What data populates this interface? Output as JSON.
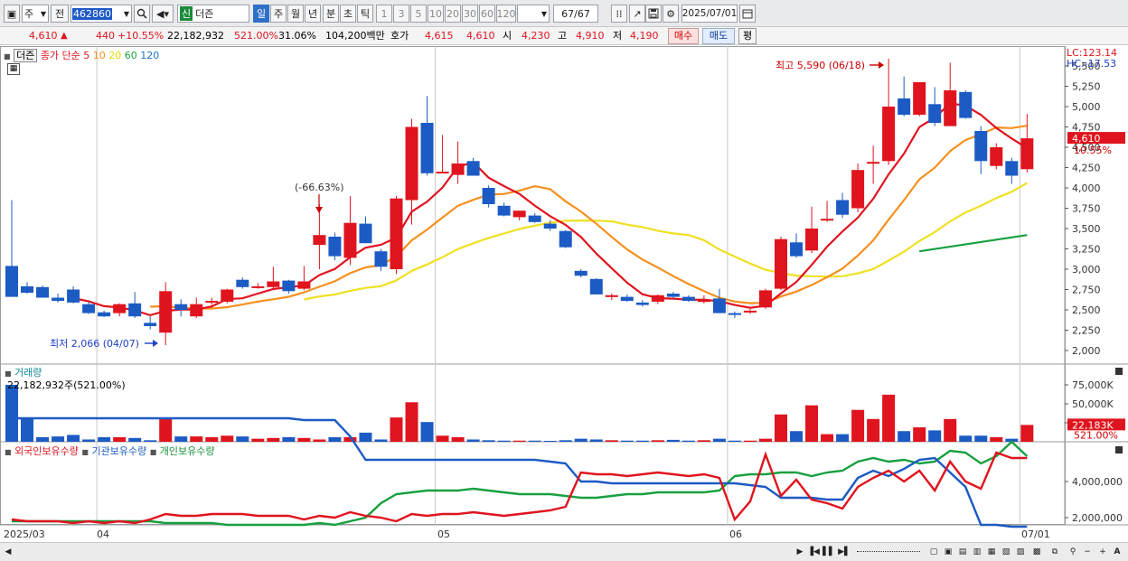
{
  "toolbar": {
    "market": "주",
    "prev_label": "전",
    "code": "462860",
    "stock_name": "더즌",
    "stock_badge": "신",
    "periods": [
      "일",
      "주",
      "월",
      "년",
      "분",
      "초",
      "틱"
    ],
    "active_period": "일",
    "ranges": [
      "1",
      "3",
      "5",
      "10",
      "20",
      "30",
      "60",
      "120"
    ],
    "count": "67",
    "count_total": "/67",
    "date": "2025/07/01"
  },
  "quote": {
    "price": "4,610",
    "change": "440",
    "change_pct": "+10.55%",
    "volume": "22,182,932",
    "volume_ratio": "521.00%",
    "turnover": "31.06%",
    "amount": "104,200백만",
    "hoga_label": "호가",
    "ask": "4,615",
    "bid": "4,610",
    "open_label": "시",
    "open": "4,230",
    "high_label": "고",
    "high": "4,910",
    "low_label": "저",
    "low": "4,190",
    "buy_label": "매수",
    "sell_label": "매도",
    "flat_label": "평"
  },
  "price_panel": {
    "tab": "더즌",
    "ma_title": "종가 단순",
    "ma_periods": [
      "5",
      "10",
      "20",
      "60",
      "120"
    ],
    "lc": "LC:123.14",
    "hc": "HC:-17.53",
    "current_tag": "4,610",
    "current_pct": "10.55%",
    "max_note": "최고 5,590 (06/18)",
    "min_note": "최저 2,066 (04/07)",
    "drop_note": "(-66.63%)",
    "y_ticks": [
      "5,500",
      "5,250",
      "5,000",
      "4,750",
      "4,500",
      "4,250",
      "4,000",
      "3,750",
      "3,500",
      "3,250",
      "3,000",
      "2,750",
      "2,500",
      "2,250",
      "2,000"
    ]
  },
  "volume_panel": {
    "title": "거래량",
    "info": "22,182,932주(521.00%)",
    "y_ticks": [
      "75,000K",
      "50,000K",
      "25,000K"
    ],
    "current_tag": "22,183K",
    "current_pct": "521.00%"
  },
  "holdings_panel": {
    "foreign": "외국인보유수량",
    "institution": "기관보유수량",
    "individual": "개인보유수량",
    "y_ticks": [
      "4,000,000",
      "2,000,000"
    ]
  },
  "x_axis": [
    "2025/03",
    "04",
    "05",
    "06",
    "07/01"
  ],
  "colors": {
    "up": "#e0141e",
    "down": "#1c5bc4",
    "ma5": "#e01420",
    "ma10": "#f5901e",
    "ma20": "#f0e020",
    "ma60": "#18a040",
    "ma120": "#1c70d0"
  },
  "chart_data": {
    "type": "candlestick",
    "candles": [
      {
        "o": 3040,
        "h": 3850,
        "l": 2660,
        "c": 2660
      },
      {
        "o": 2790,
        "h": 2840,
        "l": 2700,
        "c": 2710
      },
      {
        "o": 2780,
        "h": 2800,
        "l": 2650,
        "c": 2650
      },
      {
        "o": 2650,
        "h": 2700,
        "l": 2590,
        "c": 2610
      },
      {
        "o": 2750,
        "h": 2790,
        "l": 2580,
        "c": 2590
      },
      {
        "o": 2570,
        "h": 2600,
        "l": 2450,
        "c": 2460
      },
      {
        "o": 2470,
        "h": 2490,
        "l": 2410,
        "c": 2420
      },
      {
        "o": 2460,
        "h": 2580,
        "l": 2420,
        "c": 2570
      },
      {
        "o": 2580,
        "h": 2720,
        "l": 2400,
        "c": 2420
      },
      {
        "o": 2340,
        "h": 2420,
        "l": 2260,
        "c": 2300
      },
      {
        "o": 2220,
        "h": 2840,
        "l": 2066,
        "c": 2730
      },
      {
        "o": 2570,
        "h": 2630,
        "l": 2420,
        "c": 2500
      },
      {
        "o": 2420,
        "h": 2650,
        "l": 2400,
        "c": 2570
      },
      {
        "o": 2600,
        "h": 2650,
        "l": 2560,
        "c": 2610
      },
      {
        "o": 2600,
        "h": 2760,
        "l": 2580,
        "c": 2750
      },
      {
        "o": 2870,
        "h": 2900,
        "l": 2760,
        "c": 2780
      },
      {
        "o": 2790,
        "h": 2830,
        "l": 2760,
        "c": 2790
      },
      {
        "o": 2780,
        "h": 3030,
        "l": 2750,
        "c": 2850
      },
      {
        "o": 2860,
        "h": 2870,
        "l": 2700,
        "c": 2730
      },
      {
        "o": 2760,
        "h": 3040,
        "l": 2740,
        "c": 2850
      },
      {
        "o": 3300,
        "h": 3800,
        "l": 3000,
        "c": 3420
      },
      {
        "o": 3400,
        "h": 3450,
        "l": 3110,
        "c": 3160
      },
      {
        "o": 3140,
        "h": 3900,
        "l": 3050,
        "c": 3570
      },
      {
        "o": 3560,
        "h": 3650,
        "l": 3320,
        "c": 3320
      },
      {
        "o": 3220,
        "h": 3250,
        "l": 2980,
        "c": 3030
      },
      {
        "o": 3000,
        "h": 3900,
        "l": 2940,
        "c": 3870
      },
      {
        "o": 3850,
        "h": 4850,
        "l": 3550,
        "c": 4750
      },
      {
        "o": 4800,
        "h": 5130,
        "l": 4150,
        "c": 4180
      },
      {
        "o": 4190,
        "h": 4650,
        "l": 4180,
        "c": 4200
      },
      {
        "o": 4160,
        "h": 4570,
        "l": 4050,
        "c": 4300
      },
      {
        "o": 4330,
        "h": 4370,
        "l": 4150,
        "c": 4150
      },
      {
        "o": 4000,
        "h": 4030,
        "l": 3760,
        "c": 3800
      },
      {
        "o": 3780,
        "h": 3820,
        "l": 3650,
        "c": 3660
      },
      {
        "o": 3640,
        "h": 3720,
        "l": 3600,
        "c": 3720
      },
      {
        "o": 3660,
        "h": 3690,
        "l": 3570,
        "c": 3580
      },
      {
        "o": 3560,
        "h": 3600,
        "l": 3470,
        "c": 3500
      },
      {
        "o": 3470,
        "h": 3480,
        "l": 3260,
        "c": 3270
      },
      {
        "o": 2980,
        "h": 3000,
        "l": 2900,
        "c": 2920
      },
      {
        "o": 2880,
        "h": 2890,
        "l": 2690,
        "c": 2690
      },
      {
        "o": 2660,
        "h": 2700,
        "l": 2620,
        "c": 2680
      },
      {
        "o": 2660,
        "h": 2690,
        "l": 2600,
        "c": 2610
      },
      {
        "o": 2590,
        "h": 2620,
        "l": 2540,
        "c": 2560
      },
      {
        "o": 2600,
        "h": 2690,
        "l": 2570,
        "c": 2680
      },
      {
        "o": 2700,
        "h": 2720,
        "l": 2640,
        "c": 2660
      },
      {
        "o": 2660,
        "h": 2680,
        "l": 2600,
        "c": 2610
      },
      {
        "o": 2600,
        "h": 2680,
        "l": 2580,
        "c": 2620
      },
      {
        "o": 2640,
        "h": 2760,
        "l": 2460,
        "c": 2460
      },
      {
        "o": 2460,
        "h": 2480,
        "l": 2400,
        "c": 2450
      },
      {
        "o": 2470,
        "h": 2510,
        "l": 2450,
        "c": 2490
      },
      {
        "o": 2530,
        "h": 2760,
        "l": 2510,
        "c": 2740
      },
      {
        "o": 2760,
        "h": 3400,
        "l": 2740,
        "c": 3370
      },
      {
        "o": 3330,
        "h": 3440,
        "l": 3140,
        "c": 3160
      },
      {
        "o": 3230,
        "h": 3770,
        "l": 3200,
        "c": 3500
      },
      {
        "o": 3600,
        "h": 3840,
        "l": 3580,
        "c": 3620
      },
      {
        "o": 3850,
        "h": 3940,
        "l": 3630,
        "c": 3670
      },
      {
        "o": 3750,
        "h": 4300,
        "l": 3700,
        "c": 4220
      },
      {
        "o": 4300,
        "h": 4520,
        "l": 4050,
        "c": 4320
      },
      {
        "o": 4330,
        "h": 5590,
        "l": 4280,
        "c": 5000
      },
      {
        "o": 5100,
        "h": 5370,
        "l": 4880,
        "c": 4900
      },
      {
        "o": 4900,
        "h": 5290,
        "l": 4880,
        "c": 5300
      },
      {
        "o": 5030,
        "h": 5240,
        "l": 4760,
        "c": 4800
      },
      {
        "o": 4760,
        "h": 5540,
        "l": 4760,
        "c": 5200
      },
      {
        "o": 5180,
        "h": 5200,
        "l": 4850,
        "c": 4860
      },
      {
        "o": 4700,
        "h": 4760,
        "l": 4170,
        "c": 4330
      },
      {
        "o": 4270,
        "h": 4550,
        "l": 4230,
        "c": 4500
      },
      {
        "o": 4330,
        "h": 4370,
        "l": 4050,
        "c": 4150
      },
      {
        "o": 4230,
        "h": 4910,
        "l": 4190,
        "c": 4610
      }
    ],
    "volume_k": [
      75000,
      30000,
      6000,
      7000,
      9000,
      3000,
      6000,
      6000,
      5000,
      2000,
      32000,
      7000,
      7000,
      6000,
      8000,
      7000,
      4000,
      5000,
      6000,
      5000,
      3000,
      6000,
      6000,
      12000,
      3000,
      32000,
      52000,
      26000,
      8000,
      6000,
      3000,
      2000,
      1500,
      1500,
      1500,
      1200,
      2000,
      4000,
      3000,
      2000,
      1500,
      1500,
      2000,
      2500,
      1500,
      2000,
      4000,
      1500,
      1500,
      4000,
      36000,
      14000,
      48000,
      10000,
      10000,
      42000,
      30000,
      62000,
      14000,
      19000,
      15000,
      30000,
      8000,
      8000,
      6000,
      4000,
      22183
    ],
    "holdings": {
      "foreign": [
        1.9,
        1.8,
        1.8,
        1.8,
        1.7,
        1.8,
        1.7,
        1.8,
        1.7,
        1.9,
        2.2,
        2.1,
        2.1,
        2.2,
        2.2,
        2.2,
        2.1,
        2.1,
        2.1,
        1.9,
        2.1,
        2.0,
        2.3,
        2.1,
        2.0,
        1.8,
        2.2,
        2.1,
        2.2,
        2.2,
        2.3,
        2.2,
        2.1,
        2.2,
        2.3,
        2.4,
        2.6,
        4.5,
        4.4,
        4.4,
        4.3,
        4.4,
        4.5,
        4.4,
        4.3,
        4.4,
        4.2,
        1.9,
        2.9,
        5.5,
        3.2,
        4.1,
        3.0,
        2.8,
        2.5,
        3.7,
        4.2,
        4.6,
        4.0,
        4.6,
        3.5,
        5.1,
        4.0,
        3.6,
        5.6,
        5.3,
        5.3
      ],
      "institution": [
        7.5,
        7.5,
        7.5,
        7.5,
        7.5,
        7.5,
        7.5,
        7.5,
        7.5,
        7.5,
        7.5,
        7.5,
        7.5,
        7.5,
        7.5,
        7.5,
        7.5,
        7.5,
        7.5,
        7.4,
        7.4,
        7.4,
        6.5,
        5.2,
        5.2,
        5.2,
        5.2,
        5.2,
        5.2,
        5.2,
        5.2,
        5.2,
        5.2,
        5.2,
        5.2,
        5.1,
        5.0,
        4.0,
        4.0,
        3.9,
        3.9,
        3.9,
        3.9,
        3.9,
        3.9,
        3.9,
        3.9,
        3.9,
        3.8,
        3.7,
        3.1,
        3.1,
        3.1,
        3.0,
        3.0,
        4.2,
        4.6,
        4.3,
        4.7,
        5.2,
        5.3,
        4.5,
        3.7,
        1.6,
        1.6,
        1.5,
        1.5
      ],
      "individual": [
        1.8,
        1.8,
        1.8,
        1.8,
        1.8,
        1.8,
        1.8,
        1.8,
        1.8,
        1.8,
        1.7,
        1.7,
        1.7,
        1.7,
        1.6,
        1.6,
        1.6,
        1.6,
        1.6,
        1.6,
        1.7,
        1.6,
        1.8,
        2.0,
        2.8,
        3.3,
        3.4,
        3.5,
        3.5,
        3.5,
        3.6,
        3.5,
        3.4,
        3.3,
        3.3,
        3.3,
        3.2,
        3.1,
        3.1,
        3.2,
        3.3,
        3.3,
        3.4,
        3.4,
        3.4,
        3.4,
        3.5,
        4.3,
        4.4,
        4.4,
        4.5,
        4.5,
        4.3,
        4.5,
        4.6,
        5.1,
        5.3,
        5.1,
        5.2,
        5.0,
        5.1,
        5.7,
        5.6,
        5.0,
        5.4,
        6.2,
        5.4
      ]
    }
  }
}
